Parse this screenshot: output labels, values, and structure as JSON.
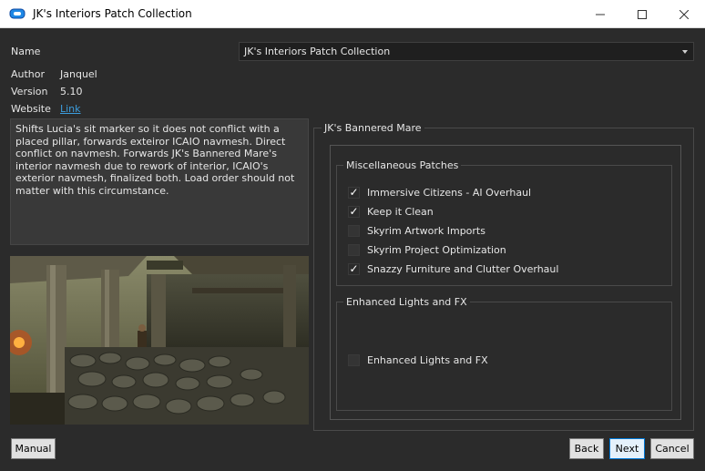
{
  "window": {
    "title": "JK's Interiors Patch Collection",
    "controls": {
      "minimize": "—",
      "maximize": "☐",
      "close": "✕"
    }
  },
  "info": {
    "name_label": "Name",
    "name_value": "JK's Interiors Patch Collection",
    "author_label": "Author",
    "author_value": "Janquel",
    "version_label": "Version",
    "version_value": "5.10",
    "website_label": "Website",
    "website_link": "Link"
  },
  "description": "Shifts Lucia's sit marker so it does not conflict with a placed pillar, forwards exteiror ICAIO navmesh. Direct conflict on navmesh. Forwards JK's Bannered Mare's interior navmesh due to rework of interior, ICAIO's exterior navmesh, finalized both. Load order should not matter with this circumstance.",
  "options": {
    "group_title": "JK's Bannered Mare",
    "misc": {
      "title": "Miscellaneous Patches",
      "items": [
        {
          "label": "Immersive Citizens - AI Overhaul",
          "checked": true
        },
        {
          "label": "Keep it Clean",
          "checked": true
        },
        {
          "label": "Skyrim Artwork Imports",
          "checked": false
        },
        {
          "label": "Skyrim Project Optimization",
          "checked": false
        },
        {
          "label": "Snazzy Furniture and Clutter Overhaul",
          "checked": true
        }
      ]
    },
    "lights": {
      "title": "Enhanced Lights and FX",
      "items": [
        {
          "label": "Enhanced Lights and FX",
          "checked": false
        }
      ]
    }
  },
  "buttons": {
    "manual": "Manual",
    "back": "Back",
    "next": "Next",
    "cancel": "Cancel"
  },
  "colors": {
    "background": "#2b2b2b",
    "link": "#3c9ddd",
    "accent": "#0078d7"
  }
}
